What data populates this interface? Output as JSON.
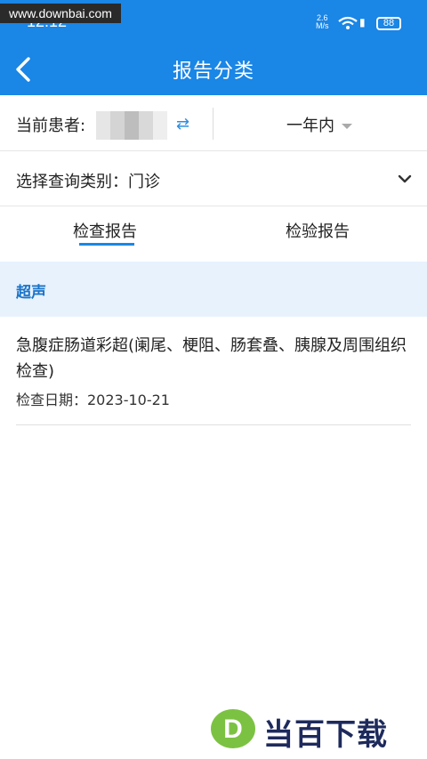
{
  "status_bar": {
    "watermark": "www.downbai.com",
    "time": "12:12",
    "net_speed_value": "2.6",
    "net_speed_unit": "M/s",
    "battery": "88"
  },
  "nav": {
    "title": "报告分类",
    "back_icon": "chevron-left-icon"
  },
  "filter": {
    "patient_label": "当前患者:",
    "patient_swap_icon": "swap-arrows-icon",
    "time_range": "一年内",
    "category_text": "选择查询类别：门诊",
    "category_icon": "chevron-down-icon"
  },
  "tabs": [
    {
      "label": "检查报告",
      "active": true
    },
    {
      "label": "检验报告",
      "active": false
    }
  ],
  "section": {
    "label": "超声"
  },
  "reports": [
    {
      "title": "急腹症肠道彩超(阑尾、梗阻、肠套叠、胰腺及周围组织检查)",
      "date": "检查日期：2023-10-21"
    }
  ],
  "brand": {
    "logo_letter": "D",
    "name": "当百下载"
  },
  "colors": {
    "header": "#1a86e6",
    "accent": "#1a86e6",
    "section_bg": "#e8f2fd",
    "section_text": "#1a74c8"
  }
}
